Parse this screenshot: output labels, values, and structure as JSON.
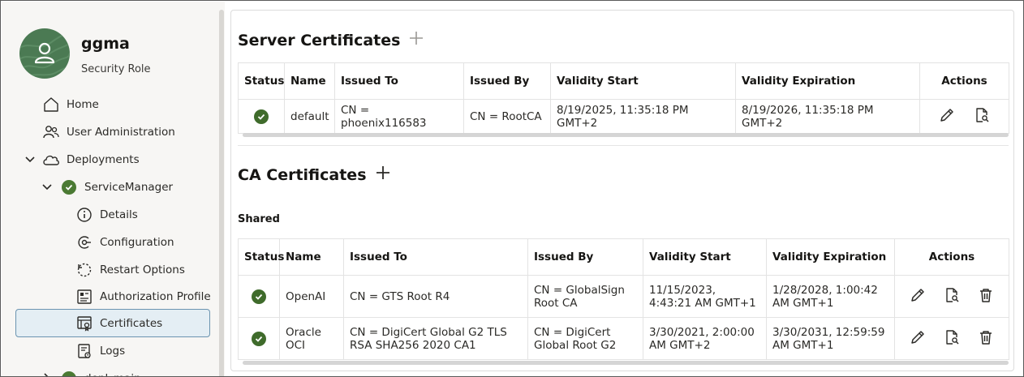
{
  "user": {
    "name": "ggma",
    "role": "Security Role"
  },
  "nav": {
    "home": "Home",
    "user_admin": "User Administration",
    "deployments": "Deployments",
    "service_manager": "ServiceManager",
    "details": "Details",
    "configuration": "Configuration",
    "restart_options": "Restart Options",
    "authorization_profile": "Authorization Profile",
    "certificates": "Certificates",
    "logs": "Logs",
    "next_deployment": "depl_main"
  },
  "server_certificates": {
    "title": "Server Certificates",
    "columns": [
      "Status",
      "Name",
      "Issued To",
      "Issued By",
      "Validity Start",
      "Validity Expiration",
      "Actions"
    ],
    "rows": [
      {
        "name": "default",
        "issued_to": "CN = phoenix116583",
        "issued_by": "CN = RootCA",
        "validity_start": "8/19/2025, 11:35:18 PM GMT+2",
        "validity_expiration": "8/19/2026, 11:35:18 PM GMT+2"
      }
    ]
  },
  "ca_certificates": {
    "title": "CA Certificates",
    "subheading": "Shared",
    "columns": [
      "Status",
      "Name",
      "Issued To",
      "Issued By",
      "Validity Start",
      "Validity Expiration",
      "Actions"
    ],
    "rows": [
      {
        "name": "OpenAI",
        "issued_to": "CN = GTS Root R4",
        "issued_by": "CN = GlobalSign Root CA",
        "validity_start": "11/15/2023, 4:43:21 AM GMT+1",
        "validity_expiration": "1/28/2028, 1:00:42 AM GMT+1"
      },
      {
        "name": "Oracle OCI",
        "issued_to": "CN = DigiCert Global G2 TLS RSA SHA256 2020 CA1",
        "issued_by": "CN = DigiCert Global Root G2",
        "validity_start": "3/30/2021, 2:00:00 AM GMT+2",
        "validity_expiration": "3/30/2031, 12:59:59 AM GMT+1"
      }
    ]
  },
  "colors": {
    "status_ok": "#3f6b2b",
    "avatar_bg": "#4b7a53",
    "selected_bg": "#e4eef4",
    "selected_border": "#6b94b0"
  }
}
